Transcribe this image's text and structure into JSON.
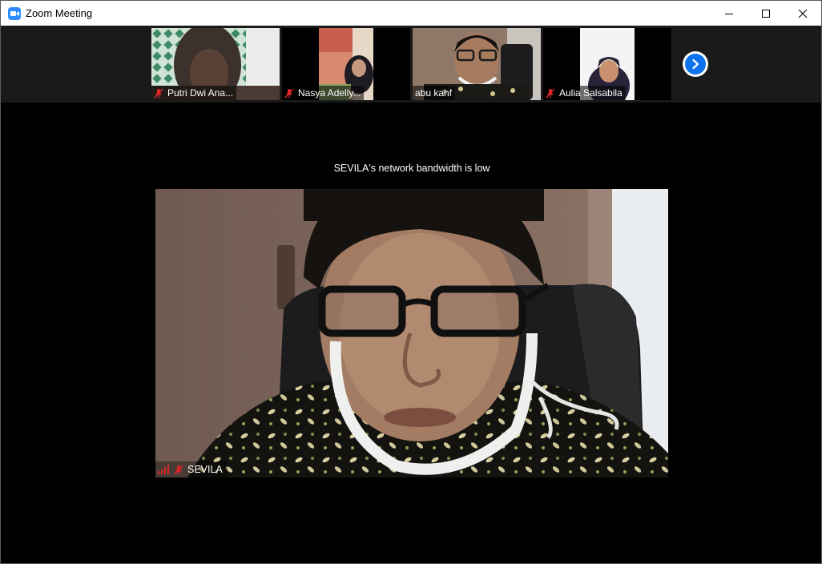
{
  "window": {
    "title": "Zoom Meeting",
    "icon": "zoom-camera-icon",
    "controls": [
      "minimize-icon",
      "maximize-icon",
      "close-icon"
    ]
  },
  "participants": [
    {
      "name": "Putri Dwi Ana...",
      "muted": true
    },
    {
      "name": "Nasya Adelly...",
      "muted": true
    },
    {
      "name": "abu kahf",
      "muted": false
    },
    {
      "name": "Aulia Salsabila",
      "muted": true
    }
  ],
  "next_page_icon": "chevron-right-icon",
  "banner": "SEVILA's network bandwidth is low",
  "active_speaker": {
    "name": "SEVILA",
    "muted": true,
    "signal_icon": "weak-signal-icon"
  },
  "colors": {
    "zoom_blue": "#0e72ed",
    "muted_red": "#e02828",
    "signal_red": "#e02828"
  }
}
